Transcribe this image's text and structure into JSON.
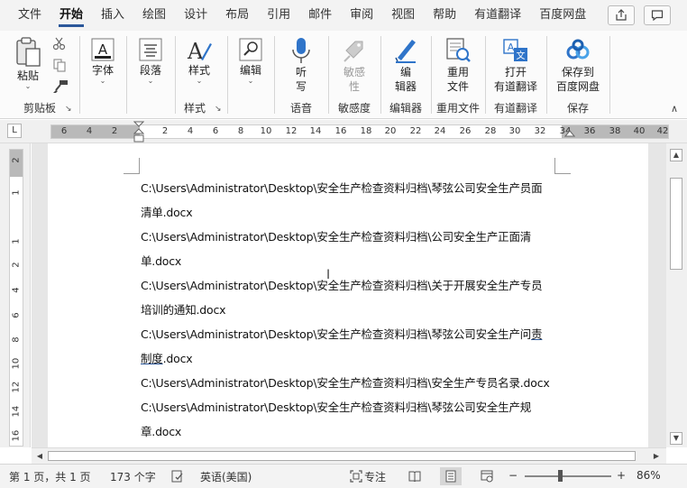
{
  "menu": {
    "tabs": [
      "文件",
      "开始",
      "插入",
      "绘图",
      "设计",
      "布局",
      "引用",
      "邮件",
      "审阅",
      "视图",
      "帮助",
      "有道翻译",
      "百度网盘"
    ],
    "active_tab": "开始"
  },
  "ribbon": {
    "clipboard": {
      "paste": "粘贴",
      "group": "剪贴板"
    },
    "font": {
      "label": "字体"
    },
    "paragraph": {
      "label": "段落"
    },
    "styles": {
      "label": "样式",
      "group": "样式"
    },
    "editing": {
      "label": "编辑"
    },
    "voice": {
      "label_line1": "听",
      "label_line2": "写",
      "group": "语音"
    },
    "sensitivity": {
      "label_line1": "敏感",
      "label_line2": "性",
      "group": "敏感度"
    },
    "editor": {
      "label_line1": "编",
      "label_line2": "辑器",
      "group": "编辑器"
    },
    "reuse": {
      "label_line1": "重用",
      "label_line2": "文件",
      "group": "重用文件"
    },
    "youdao": {
      "label_line1": "打开",
      "label_line2": "有道翻译",
      "group": "有道翻译"
    },
    "baidu": {
      "label_line1": "保存到",
      "label_line2": "百度网盘",
      "group": "保存"
    }
  },
  "ruler": {
    "corner": "L",
    "numbers": [
      "6",
      "4",
      "2",
      "2",
      "4",
      "6",
      "8",
      "10",
      "12",
      "14",
      "16",
      "18",
      "20",
      "22",
      "24",
      "26",
      "28",
      "30",
      "32",
      "34",
      "36",
      "38",
      "40",
      "42"
    ],
    "vertical_numbers": [
      "2",
      "1",
      "1",
      "2",
      "4",
      "6",
      "8",
      "10",
      "12",
      "14",
      "16"
    ]
  },
  "document": {
    "lines": [
      "C:\\Users\\Administrator\\Desktop\\安全生产检查资料归档\\琴弦公司安全生产员面",
      "清单.docx",
      "C:\\Users\\Administrator\\Desktop\\安全生产检查资料归档\\公司安全生产正面清",
      "单.docx",
      "C:\\Users\\Administrator\\Desktop\\安全生产检查资料归档\\关于开展安全生产专员",
      "培训的通知.docx",
      "C:\\Users\\Administrator\\Desktop\\安全生产检查资料归档\\琴弦公司安全生产问",
      "制度.docx",
      "C:\\Users\\Administrator\\Desktop\\安全生产检查资料归档\\安全生产专员名录.docx",
      "C:\\Users\\Administrator\\Desktop\\安全生产检查资料归档\\琴弦公司安全生产规",
      "章.docx"
    ],
    "underlined_tail": "责",
    "underlined_head": "制度",
    "line7_head": "C:\\Users\\Administrator\\Desktop\\安全生产检查资料归档\\琴弦公司安全生产问",
    "line8_tail": ".docx"
  },
  "status": {
    "page": "第 1 页，共 1 页",
    "words": "173 个字",
    "language": "英语(美国)",
    "focus": "专注",
    "zoom_minus": "−",
    "zoom_plus": "+",
    "zoom": "86%"
  },
  "colors": {
    "accent": "#2b579a",
    "blue_icon": "#2f74c9"
  }
}
